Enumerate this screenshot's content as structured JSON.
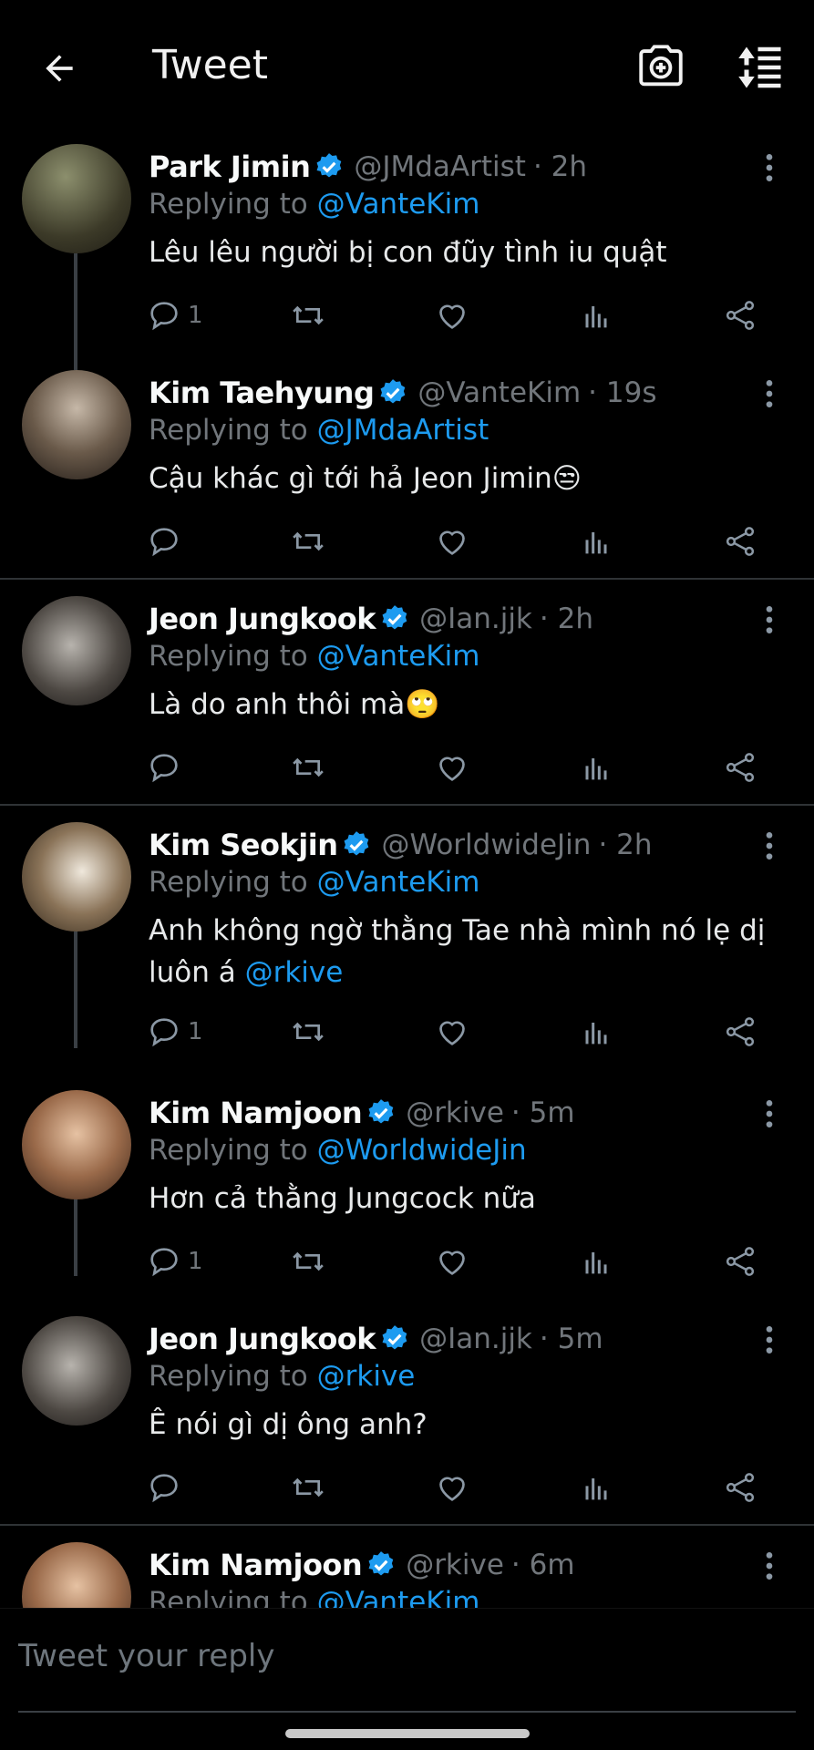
{
  "header": {
    "title": "Tweet"
  },
  "tweets": [
    {
      "name": "Park Jimin",
      "handle": "@JMdaArtist",
      "time": "· 2h",
      "reply_prefix": "Replying to",
      "reply_to": "@VanteKim",
      "text": "Lêu lêu người bị con đũy tình iu quật",
      "reply_count": "1"
    },
    {
      "name": "Kim Taehyung",
      "handle": "@VanteKim",
      "time": "· 19s",
      "reply_prefix": "Replying to",
      "reply_to": "@JMdaArtist",
      "text": "Cậu khác gì tới hả Jeon Jimin😒",
      "reply_count": ""
    },
    {
      "name": "Jeon Jungkook",
      "handle": "@Ian.jjk",
      "time": "· 2h",
      "reply_prefix": "Replying to",
      "reply_to": "@VanteKim",
      "text": "Là do anh thôi mà🙄",
      "reply_count": ""
    },
    {
      "name": "Kim Seokjin",
      "handle": "@WorldwideJin",
      "time": "· 2h",
      "reply_prefix": "Replying to",
      "reply_to": "@VanteKim",
      "text": "Anh không ngờ thằng Tae nhà mình nó lẹ dị luôn á",
      "text_mention": "@rkive",
      "reply_count": "1"
    },
    {
      "name": "Kim Namjoon",
      "handle": "@rkive",
      "time": "· 5m",
      "reply_prefix": "Replying to",
      "reply_to": "@WorldwideJin",
      "text": "Hơn cả thằng Jungcock nữa",
      "reply_count": "1"
    },
    {
      "name": "Jeon Jungkook",
      "handle": "@Ian.jjk",
      "time": "· 5m",
      "reply_prefix": "Replying to",
      "reply_to": "@rkive",
      "text": "Ê nói gì dị ông anh?",
      "reply_count": ""
    },
    {
      "name": "Kim Namjoon",
      "handle": "@rkive",
      "time": "· 6m",
      "reply_prefix": "Replying to",
      "reply_to": "@VanteKim",
      "text": "",
      "reply_count": ""
    }
  ],
  "reply_box": {
    "placeholder": "Tweet your reply"
  },
  "colors": {
    "accent": "#1d9bf0",
    "muted": "#71767b",
    "background": "#000000"
  }
}
